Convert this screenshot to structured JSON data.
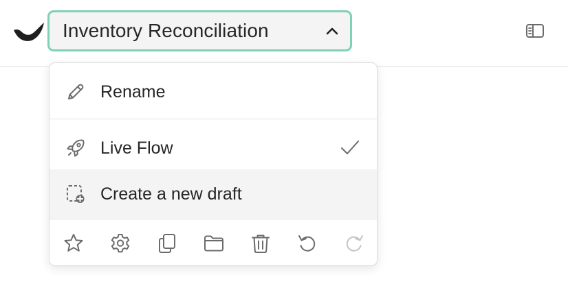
{
  "header": {
    "title": "Inventory Reconciliation",
    "logo_icon": "brand-logo",
    "title_chevron_icon": "chevron-up-icon",
    "panel_toggle_icon": "sidebar-panel-icon"
  },
  "menu": {
    "items": [
      {
        "label": "Rename",
        "icon": "pencil-icon"
      },
      {
        "label": "Live Flow",
        "icon": "rocket-icon",
        "checked": true
      },
      {
        "label": "Create a new draft",
        "icon": "new-draft-icon",
        "hovered": true
      }
    ],
    "toolbar": [
      {
        "icon": "star-icon"
      },
      {
        "icon": "gear-icon"
      },
      {
        "icon": "duplicate-icon"
      },
      {
        "icon": "folder-icon"
      },
      {
        "icon": "trash-icon"
      },
      {
        "icon": "undo-icon"
      },
      {
        "icon": "redo-icon",
        "disabled": true
      }
    ]
  },
  "colors": {
    "focus_border": "#7fd0b5",
    "title_bg": "#f4f4f4",
    "icon_gray": "#6b6b6b",
    "disabled_gray": "#c4c4c4",
    "hover_bg": "#f4f4f4"
  }
}
